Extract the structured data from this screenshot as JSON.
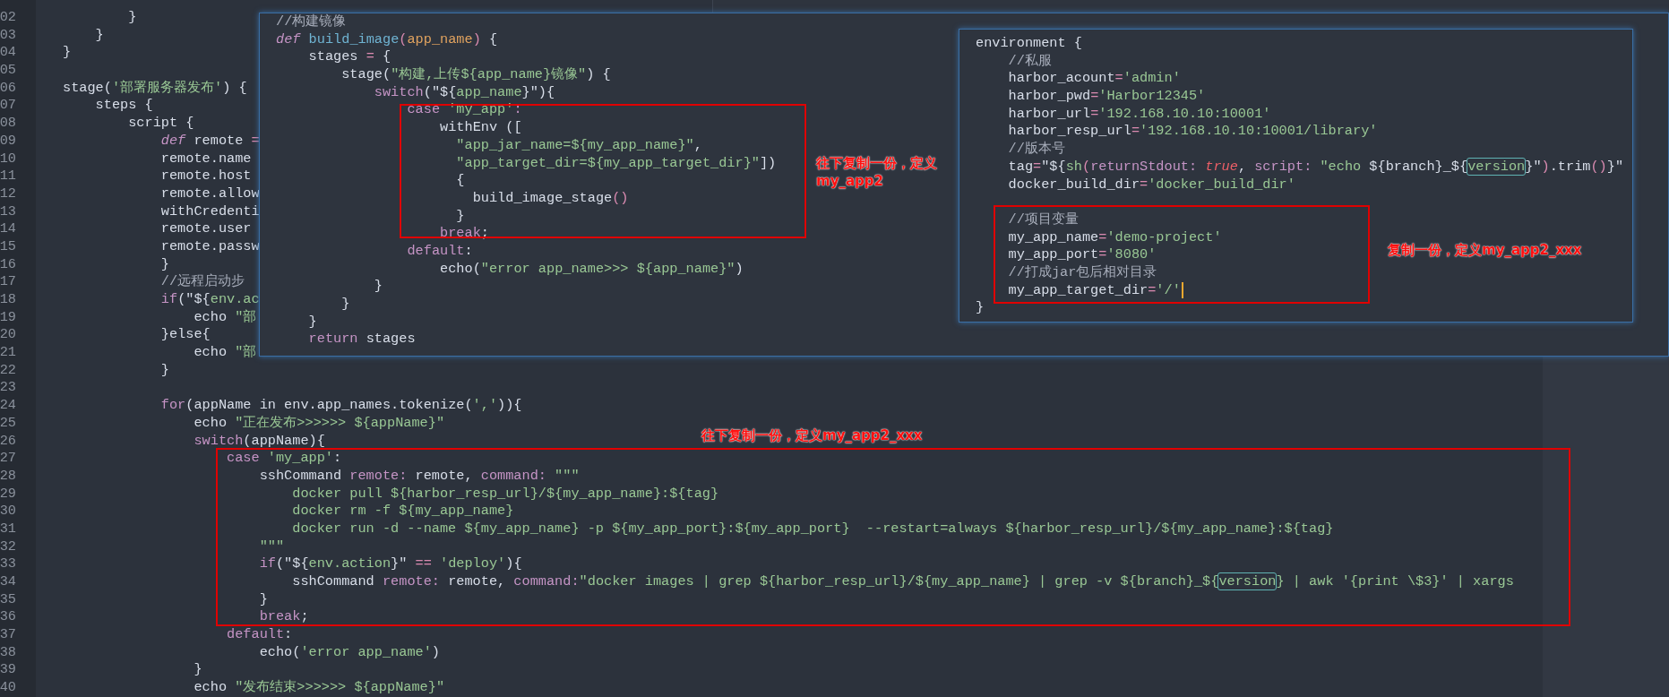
{
  "editor": {
    "lines": [
      {
        "num": "02",
        "tokens": [
          {
            "kind": "plain",
            "text": "        }"
          }
        ]
      },
      {
        "num": "03",
        "tokens": [
          {
            "kind": "plain",
            "text": "    }"
          }
        ]
      },
      {
        "num": "04",
        "tokens": [
          {
            "kind": "plain",
            "text": "}"
          }
        ]
      },
      {
        "num": "05"
      },
      {
        "num": "06",
        "tokens": [
          {
            "kind": "plain",
            "text": "stage("
          },
          {
            "kind": "str",
            "text": "'部署服务器发布'"
          },
          {
            "kind": "plain",
            "text": ") {"
          }
        ]
      },
      {
        "num": "07",
        "tokens": [
          {
            "kind": "plain",
            "text": "    steps {"
          }
        ]
      },
      {
        "num": "08",
        "tokens": [
          {
            "kind": "plain",
            "text": "        script {"
          }
        ]
      },
      {
        "num": "09",
        "tokens": [
          {
            "kind": "def",
            "text": "            def"
          },
          {
            "kind": "plain",
            "text": " remote "
          },
          {
            "kind": "op",
            "text": "="
          }
        ]
      },
      {
        "num": "10",
        "tokens": [
          {
            "kind": "plain",
            "text": "            remote.name"
          }
        ]
      },
      {
        "num": "11",
        "tokens": [
          {
            "kind": "plain",
            "text": "            remote.host"
          }
        ]
      },
      {
        "num": "12",
        "tokens": [
          {
            "kind": "plain",
            "text": "            remote.allow"
          }
        ]
      },
      {
        "num": "13",
        "tokens": [
          {
            "kind": "plain",
            "text": "            withCredenti"
          }
        ]
      },
      {
        "num": "14",
        "tokens": [
          {
            "kind": "plain",
            "text": "            remote.user"
          }
        ]
      },
      {
        "num": "15",
        "tokens": [
          {
            "kind": "plain",
            "text": "            remote.passw"
          }
        ]
      },
      {
        "num": "16",
        "tokens": [
          {
            "kind": "plain",
            "text": "            }"
          }
        ]
      },
      {
        "num": "17",
        "tokens": [
          {
            "kind": "cm",
            "text": "            //远程启动步"
          }
        ]
      },
      {
        "num": "18",
        "tokens": [
          {
            "kind": "kw",
            "text": "            if"
          },
          {
            "kind": "plain",
            "text": "(\"${"
          },
          {
            "kind": "str",
            "text": "env.ac"
          }
        ]
      },
      {
        "num": "19",
        "tokens": [
          {
            "kind": "plain",
            "text": "                echo "
          },
          {
            "kind": "str",
            "text": "\"部"
          }
        ]
      },
      {
        "num": "20",
        "tokens": [
          {
            "kind": "plain",
            "text": "            }else{"
          }
        ]
      },
      {
        "num": "21",
        "tokens": [
          {
            "kind": "plain",
            "text": "                echo "
          },
          {
            "kind": "str",
            "text": "\"部"
          }
        ]
      },
      {
        "num": "22",
        "tokens": [
          {
            "kind": "plain",
            "text": "            }"
          }
        ]
      },
      {
        "num": "23"
      },
      {
        "num": "24",
        "tokens": [
          {
            "kind": "kw",
            "text": "            for"
          },
          {
            "kind": "plain",
            "text": "(appName in env.app_names.tokenize("
          },
          {
            "kind": "str",
            "text": "','"
          },
          {
            "kind": "plain",
            "text": ")){"
          }
        ]
      },
      {
        "num": "25",
        "tokens": [
          {
            "kind": "plain",
            "text": "                echo "
          },
          {
            "kind": "str",
            "text": "\"正在发布>>>>>> ${appName}\""
          }
        ]
      },
      {
        "num": "26",
        "tokens": [
          {
            "kind": "kw",
            "text": "                switch"
          },
          {
            "kind": "plain",
            "text": "(appName){"
          }
        ]
      },
      {
        "num": "27",
        "tokens": [
          {
            "kind": "kw",
            "text": "                    case "
          },
          {
            "kind": "str",
            "text": "'my_app'"
          },
          {
            "kind": "plain",
            "text": ":"
          }
        ]
      },
      {
        "num": "28",
        "tokens": [
          {
            "kind": "plain",
            "text": "                        sshCommand "
          },
          {
            "kind": "kw",
            "text": "remote:"
          },
          {
            "kind": "plain",
            "text": " remote, "
          },
          {
            "kind": "kw",
            "text": "command:"
          },
          {
            "kind": "str",
            "text": " \"\"\""
          }
        ]
      },
      {
        "num": "29",
        "tokens": [
          {
            "kind": "str",
            "text": "                            docker pull ${harbor_resp_url}/${my_app_name}:${tag}"
          }
        ]
      },
      {
        "num": "30",
        "tokens": [
          {
            "kind": "str",
            "text": "                            docker rm -f ${my_app_name}"
          }
        ]
      },
      {
        "num": "31",
        "tokens": [
          {
            "kind": "str",
            "text": "                            docker run -d --name ${my_app_name} -p ${my_app_port}:${my_app_port}  --restart=always ${harbor_resp_url}/${my_app_name}:${tag}"
          }
        ]
      },
      {
        "num": "32",
        "tokens": [
          {
            "kind": "str",
            "text": "                        \"\"\""
          }
        ]
      },
      {
        "num": "33",
        "tokens": [
          {
            "kind": "kw",
            "text": "                        if"
          },
          {
            "kind": "plain",
            "text": "(\"${"
          },
          {
            "kind": "str",
            "text": "env.action"
          },
          {
            "kind": "plain",
            "text": "}\" "
          },
          {
            "kind": "op",
            "text": "=="
          },
          {
            "kind": "str",
            "text": " 'deploy'"
          },
          {
            "kind": "plain",
            "text": "){"
          }
        ]
      },
      {
        "num": "34",
        "tokens": [
          {
            "kind": "plain",
            "text": "                            sshCommand "
          },
          {
            "kind": "kw",
            "text": "remote:"
          },
          {
            "kind": "plain",
            "text": " remote, "
          },
          {
            "kind": "kw",
            "text": "command:"
          },
          {
            "kind": "str",
            "text": "\"docker images | grep ${harbor_resp_url}/${my_app_name} | grep -v ${branch}_${"
          },
          {
            "kind": "match",
            "text": "version"
          },
          {
            "kind": "str",
            "text": "} | awk '{print \\$3}' | xargs"
          }
        ]
      },
      {
        "num": "35",
        "tokens": [
          {
            "kind": "plain",
            "text": "                        }"
          }
        ]
      },
      {
        "num": "36",
        "tokens": [
          {
            "kind": "kw",
            "text": "                        break"
          },
          {
            "kind": "plain",
            "text": ";"
          }
        ]
      },
      {
        "num": "37",
        "tokens": [
          {
            "kind": "kw",
            "text": "                    default"
          },
          {
            "kind": "plain",
            "text": ":"
          }
        ]
      },
      {
        "num": "38",
        "tokens": [
          {
            "kind": "plain",
            "text": "                        echo("
          },
          {
            "kind": "str",
            "text": "'error app_name'"
          },
          {
            "kind": "plain",
            "text": ")"
          }
        ]
      },
      {
        "num": "39",
        "tokens": [
          {
            "kind": "plain",
            "text": "                }"
          }
        ]
      },
      {
        "num": "40",
        "tokens": [
          {
            "kind": "plain",
            "text": "                echo "
          },
          {
            "kind": "str",
            "text": "\"发布结束>>>>>> ${appName}\""
          }
        ]
      }
    ],
    "annotation": "往下复制一份，定义my_app2_xxx"
  },
  "popup_build": {
    "lines": [
      {
        "tokens": [
          {
            "kind": "cm",
            "text": "//构建镜像"
          }
        ]
      },
      {
        "tokens": [
          {
            "kind": "def",
            "text": "def"
          },
          {
            "kind": "fn",
            "text": " build_image"
          },
          {
            "kind": "op",
            "text": "("
          },
          {
            "kind": "param",
            "text": "app_name"
          },
          {
            "kind": "op",
            "text": ")"
          },
          {
            "kind": "plain",
            "text": " {"
          }
        ]
      },
      {
        "tokens": [
          {
            "kind": "plain",
            "text": "    stages "
          },
          {
            "kind": "op",
            "text": "="
          },
          {
            "kind": "plain",
            "text": " {"
          }
        ]
      },
      {
        "tokens": [
          {
            "kind": "plain",
            "text": "        stage("
          },
          {
            "kind": "str",
            "text": "\"构建,上传${app_name}镜像\""
          },
          {
            "kind": "plain",
            "text": ") {"
          }
        ]
      },
      {
        "tokens": [
          {
            "kind": "kw",
            "text": "            switch"
          },
          {
            "kind": "plain",
            "text": "(\"${"
          },
          {
            "kind": "str",
            "text": "app_name"
          },
          {
            "kind": "plain",
            "text": "}\"){"
          }
        ]
      },
      {
        "tokens": [
          {
            "kind": "kw",
            "text": "                case "
          },
          {
            "kind": "str",
            "text": "'my_app'"
          },
          {
            "kind": "kw",
            "text": ":"
          }
        ]
      },
      {
        "tokens": [
          {
            "kind": "plain",
            "text": "                    withEnv (["
          }
        ]
      },
      {
        "tokens": [
          {
            "kind": "str",
            "text": "                      \"app_jar_name=${my_app_name}\""
          },
          {
            "kind": "plain",
            "text": ","
          }
        ]
      },
      {
        "tokens": [
          {
            "kind": "str",
            "text": "                      \"app_target_dir=${my_app_target_dir}\""
          },
          {
            "kind": "plain",
            "text": "])"
          }
        ]
      },
      {
        "tokens": [
          {
            "kind": "plain",
            "text": "                      {"
          }
        ]
      },
      {
        "tokens": [
          {
            "kind": "plain",
            "text": "                        build_image_stage"
          },
          {
            "kind": "op",
            "text": "()"
          }
        ]
      },
      {
        "tokens": [
          {
            "kind": "plain",
            "text": "                      }"
          }
        ]
      },
      {
        "tokens": [
          {
            "kind": "kw",
            "text": "                    break"
          },
          {
            "kind": "plain",
            "text": ";"
          }
        ]
      },
      {
        "tokens": [
          {
            "kind": "kw",
            "text": "                default"
          },
          {
            "kind": "plain",
            "text": ":"
          }
        ]
      },
      {
        "tokens": [
          {
            "kind": "plain",
            "text": "                    echo("
          },
          {
            "kind": "str",
            "text": "\"error app_name>>> ${app_name}\""
          },
          {
            "kind": "plain",
            "text": ")"
          }
        ]
      },
      {
        "tokens": [
          {
            "kind": "plain",
            "text": "            }"
          }
        ]
      },
      {
        "tokens": [
          {
            "kind": "plain",
            "text": "        }"
          }
        ]
      },
      {
        "tokens": [
          {
            "kind": "plain",
            "text": "    }"
          }
        ]
      },
      {
        "tokens": [
          {
            "kind": "kw",
            "text": "    return"
          },
          {
            "kind": "plain",
            "text": " stages"
          }
        ]
      }
    ],
    "annotation": "往下复制一份，定义my_app2"
  },
  "popup_env": {
    "blocks": [
      {
        "lines": [
          {
            "tokens": [
              {
                "kind": "plain",
                "text": "environment {"
              }
            ]
          },
          {
            "tokens": [
              {
                "kind": "cm",
                "text": "    //私服"
              }
            ]
          },
          {
            "tokens": [
              {
                "kind": "plain",
                "text": "    harbor_acount"
              },
              {
                "kind": "op",
                "text": "="
              },
              {
                "kind": "str",
                "text": "'admin'"
              }
            ]
          },
          {
            "tokens": [
              {
                "kind": "plain",
                "text": "    harbor_pwd"
              },
              {
                "kind": "op",
                "text": "="
              },
              {
                "kind": "str",
                "text": "'Harbor12345'"
              }
            ]
          },
          {
            "tokens": [
              {
                "kind": "plain",
                "text": "    harbor_url"
              },
              {
                "kind": "op",
                "text": "="
              },
              {
                "kind": "str",
                "text": "'192.168.10.10:10001'"
              }
            ]
          },
          {
            "tokens": [
              {
                "kind": "plain",
                "text": "    harbor_resp_url"
              },
              {
                "kind": "op",
                "text": "="
              },
              {
                "kind": "str",
                "text": "'192.168.10.10:10001/library'"
              }
            ]
          },
          {
            "tokens": [
              {
                "kind": "cm",
                "text": "    //版本号"
              }
            ]
          },
          {
            "tokens": [
              {
                "kind": "plain",
                "text": "    tag"
              },
              {
                "kind": "op",
                "text": "="
              },
              {
                "kind": "plain",
                "text": "\"${"
              },
              {
                "kind": "str",
                "text": "sh"
              },
              {
                "kind": "op",
                "text": "("
              },
              {
                "kind": "kw",
                "text": "returnStdout:"
              },
              {
                "kind": "bool",
                "text": " true"
              },
              {
                "kind": "plain",
                "text": ", "
              },
              {
                "kind": "kw",
                "text": "script:"
              },
              {
                "kind": "str",
                "text": " \"echo "
              },
              {
                "kind": "plain",
                "text": "${branch}_${"
              },
              {
                "kind": "match",
                "text": "version"
              },
              {
                "kind": "plain",
                "text": "}\""
              },
              {
                "kind": "op",
                "text": ")"
              },
              {
                "kind": "plain",
                "text": ".trim"
              },
              {
                "kind": "op",
                "text": "()"
              },
              {
                "kind": "plain",
                "text": "}\""
              }
            ]
          },
          {
            "tokens": [
              {
                "kind": "plain",
                "text": "    docker_build_dir"
              },
              {
                "kind": "op",
                "text": "="
              },
              {
                "kind": "str",
                "text": "'docker_build_dir'"
              }
            ]
          }
        ]
      },
      {
        "lines": [
          {
            "tokens": [
              {
                "kind": "cm",
                "text": "    //项目变量"
              }
            ]
          },
          {
            "tokens": [
              {
                "kind": "plain",
                "text": "    my_app_name"
              },
              {
                "kind": "op",
                "text": "="
              },
              {
                "kind": "str",
                "text": "'demo-project'"
              }
            ]
          },
          {
            "tokens": [
              {
                "kind": "plain",
                "text": "    my_app_port"
              },
              {
                "kind": "op",
                "text": "="
              },
              {
                "kind": "str",
                "text": "'8080'"
              }
            ]
          },
          {
            "tokens": [
              {
                "kind": "cm",
                "text": "    //打成jar包后相对目录"
              }
            ]
          },
          {
            "tokens": [
              {
                "kind": "plain",
                "text": "    my_app_target_dir"
              },
              {
                "kind": "op",
                "text": "="
              },
              {
                "kind": "str",
                "text": "'/'"
              }
            ],
            "cursor": true
          },
          {
            "tokens": [
              {
                "kind": "plain",
                "text": "}"
              }
            ]
          }
        ]
      }
    ],
    "annotation": "复制一份，定义my_app2_xxx"
  }
}
